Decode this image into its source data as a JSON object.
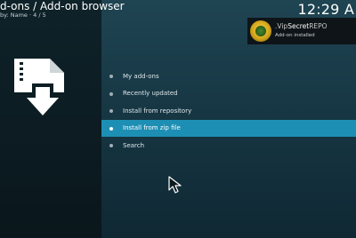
{
  "header": {
    "breadcrumb": "d-ons / Add-on browser",
    "sort_info": "by: Name · 4 / 5",
    "clock": "12:29 A"
  },
  "menu": {
    "items": [
      {
        "label": "My add-ons"
      },
      {
        "label": "Recently updated"
      },
      {
        "label": "Install from repository"
      },
      {
        "label": "Install from zip file"
      },
      {
        "label": "Search"
      }
    ],
    "selected_index": 3
  },
  "notification": {
    "title_prefix": ".Vip",
    "title_main": "Secret",
    "title_suffix": "REPO",
    "subtitle": "Add-on installed"
  },
  "icons": {
    "main": "zip-file-download-icon",
    "cursor": "mouse-pointer-icon"
  },
  "colors": {
    "accent": "#1e8fb4",
    "background": "#173744"
  }
}
